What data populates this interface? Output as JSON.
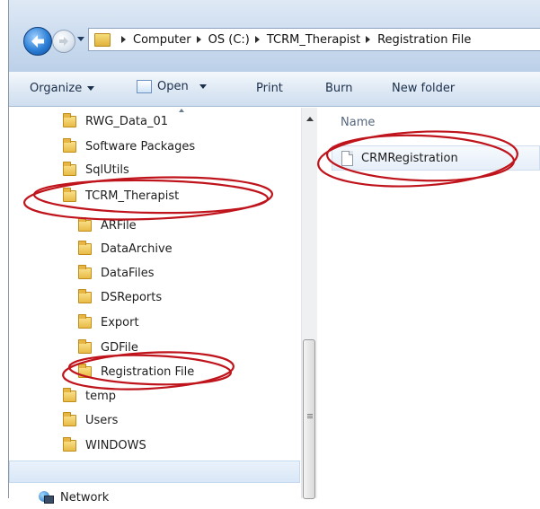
{
  "breadcrumb": {
    "items": [
      "Computer",
      "OS (C:)",
      "TCRM_Therapist",
      "Registration File"
    ]
  },
  "toolbar": {
    "organize_label": "Organize",
    "open_label": "Open",
    "print_label": "Print",
    "burn_label": "Burn",
    "new_folder_label": "New folder"
  },
  "nav_tree": {
    "items": [
      {
        "label": "RWG_Data_01"
      },
      {
        "label": "Software Packages"
      },
      {
        "label": "SqlUtils"
      },
      {
        "label": "TCRM_Therapist"
      },
      {
        "label": "ARFile"
      },
      {
        "label": "DataArchive"
      },
      {
        "label": "DataFiles"
      },
      {
        "label": "DSReports"
      },
      {
        "label": "Export"
      },
      {
        "label": "GDFile"
      },
      {
        "label": "Registration File"
      },
      {
        "label": "temp"
      },
      {
        "label": "Users"
      },
      {
        "label": "WINDOWS"
      }
    ],
    "network_label": "Network"
  },
  "content": {
    "column_name": "Name",
    "files": [
      {
        "name": "CRMRegistration"
      }
    ]
  },
  "colors": {
    "annotation": "#c0141c",
    "toolbar_text": "#1c2f4a",
    "selection": "#d9e7f7"
  }
}
